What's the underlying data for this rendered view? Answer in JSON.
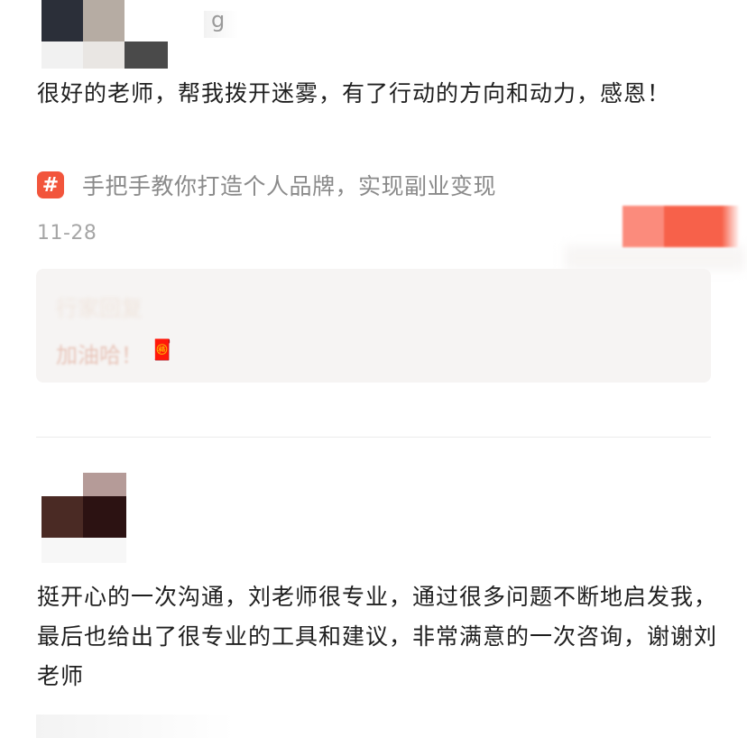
{
  "reviews": [
    {
      "username_visible": "g",
      "comment": "很好的老师，帮我拨开迷雾，有了行动的方向和动力，感恩！",
      "topic_icon": "#",
      "topic": "手把手教你打造个人品牌，实现副业变现",
      "date": "11-28",
      "reply": {
        "heading": "行家回复",
        "text": "加油哈！",
        "emoji": "🧧"
      }
    },
    {
      "comment": "挺开心的一次沟通，刘老师很专业，通过很多问题不断地启发我，最后也给出了很专业的工具和建议，非常满意的一次咨询，谢谢刘老师"
    }
  ],
  "colors": {
    "topic_icon_bg": "#f2553c",
    "reply_bg": "#f6f4f3",
    "date_text": "#a6a6a6",
    "topic_text": "#8a8a8a"
  }
}
